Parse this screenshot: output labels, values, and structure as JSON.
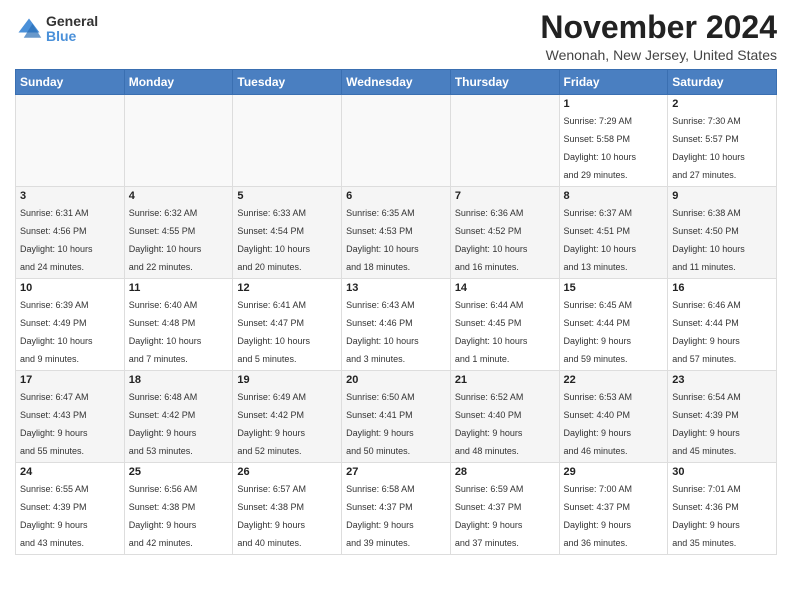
{
  "logo": {
    "general": "General",
    "blue": "Blue"
  },
  "title": "November 2024",
  "location": "Wenonah, New Jersey, United States",
  "weekdays": [
    "Sunday",
    "Monday",
    "Tuesday",
    "Wednesday",
    "Thursday",
    "Friday",
    "Saturday"
  ],
  "weeks": [
    [
      {
        "day": "",
        "info": ""
      },
      {
        "day": "",
        "info": ""
      },
      {
        "day": "",
        "info": ""
      },
      {
        "day": "",
        "info": ""
      },
      {
        "day": "",
        "info": ""
      },
      {
        "day": "1",
        "info": "Sunrise: 7:29 AM\nSunset: 5:58 PM\nDaylight: 10 hours\nand 29 minutes."
      },
      {
        "day": "2",
        "info": "Sunrise: 7:30 AM\nSunset: 5:57 PM\nDaylight: 10 hours\nand 27 minutes."
      }
    ],
    [
      {
        "day": "3",
        "info": "Sunrise: 6:31 AM\nSunset: 4:56 PM\nDaylight: 10 hours\nand 24 minutes."
      },
      {
        "day": "4",
        "info": "Sunrise: 6:32 AM\nSunset: 4:55 PM\nDaylight: 10 hours\nand 22 minutes."
      },
      {
        "day": "5",
        "info": "Sunrise: 6:33 AM\nSunset: 4:54 PM\nDaylight: 10 hours\nand 20 minutes."
      },
      {
        "day": "6",
        "info": "Sunrise: 6:35 AM\nSunset: 4:53 PM\nDaylight: 10 hours\nand 18 minutes."
      },
      {
        "day": "7",
        "info": "Sunrise: 6:36 AM\nSunset: 4:52 PM\nDaylight: 10 hours\nand 16 minutes."
      },
      {
        "day": "8",
        "info": "Sunrise: 6:37 AM\nSunset: 4:51 PM\nDaylight: 10 hours\nand 13 minutes."
      },
      {
        "day": "9",
        "info": "Sunrise: 6:38 AM\nSunset: 4:50 PM\nDaylight: 10 hours\nand 11 minutes."
      }
    ],
    [
      {
        "day": "10",
        "info": "Sunrise: 6:39 AM\nSunset: 4:49 PM\nDaylight: 10 hours\nand 9 minutes."
      },
      {
        "day": "11",
        "info": "Sunrise: 6:40 AM\nSunset: 4:48 PM\nDaylight: 10 hours\nand 7 minutes."
      },
      {
        "day": "12",
        "info": "Sunrise: 6:41 AM\nSunset: 4:47 PM\nDaylight: 10 hours\nand 5 minutes."
      },
      {
        "day": "13",
        "info": "Sunrise: 6:43 AM\nSunset: 4:46 PM\nDaylight: 10 hours\nand 3 minutes."
      },
      {
        "day": "14",
        "info": "Sunrise: 6:44 AM\nSunset: 4:45 PM\nDaylight: 10 hours\nand 1 minute."
      },
      {
        "day": "15",
        "info": "Sunrise: 6:45 AM\nSunset: 4:44 PM\nDaylight: 9 hours\nand 59 minutes."
      },
      {
        "day": "16",
        "info": "Sunrise: 6:46 AM\nSunset: 4:44 PM\nDaylight: 9 hours\nand 57 minutes."
      }
    ],
    [
      {
        "day": "17",
        "info": "Sunrise: 6:47 AM\nSunset: 4:43 PM\nDaylight: 9 hours\nand 55 minutes."
      },
      {
        "day": "18",
        "info": "Sunrise: 6:48 AM\nSunset: 4:42 PM\nDaylight: 9 hours\nand 53 minutes."
      },
      {
        "day": "19",
        "info": "Sunrise: 6:49 AM\nSunset: 4:42 PM\nDaylight: 9 hours\nand 52 minutes."
      },
      {
        "day": "20",
        "info": "Sunrise: 6:50 AM\nSunset: 4:41 PM\nDaylight: 9 hours\nand 50 minutes."
      },
      {
        "day": "21",
        "info": "Sunrise: 6:52 AM\nSunset: 4:40 PM\nDaylight: 9 hours\nand 48 minutes."
      },
      {
        "day": "22",
        "info": "Sunrise: 6:53 AM\nSunset: 4:40 PM\nDaylight: 9 hours\nand 46 minutes."
      },
      {
        "day": "23",
        "info": "Sunrise: 6:54 AM\nSunset: 4:39 PM\nDaylight: 9 hours\nand 45 minutes."
      }
    ],
    [
      {
        "day": "24",
        "info": "Sunrise: 6:55 AM\nSunset: 4:39 PM\nDaylight: 9 hours\nand 43 minutes."
      },
      {
        "day": "25",
        "info": "Sunrise: 6:56 AM\nSunset: 4:38 PM\nDaylight: 9 hours\nand 42 minutes."
      },
      {
        "day": "26",
        "info": "Sunrise: 6:57 AM\nSunset: 4:38 PM\nDaylight: 9 hours\nand 40 minutes."
      },
      {
        "day": "27",
        "info": "Sunrise: 6:58 AM\nSunset: 4:37 PM\nDaylight: 9 hours\nand 39 minutes."
      },
      {
        "day": "28",
        "info": "Sunrise: 6:59 AM\nSunset: 4:37 PM\nDaylight: 9 hours\nand 37 minutes."
      },
      {
        "day": "29",
        "info": "Sunrise: 7:00 AM\nSunset: 4:37 PM\nDaylight: 9 hours\nand 36 minutes."
      },
      {
        "day": "30",
        "info": "Sunrise: 7:01 AM\nSunset: 4:36 PM\nDaylight: 9 hours\nand 35 minutes."
      }
    ]
  ]
}
